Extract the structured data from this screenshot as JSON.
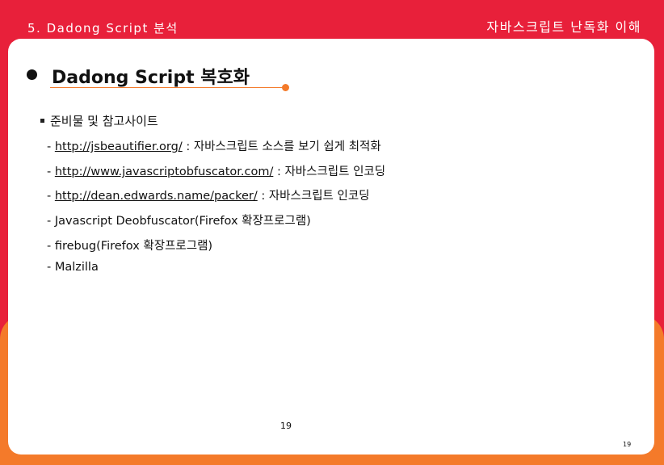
{
  "header": {
    "section": "5. Dadong Script 분석",
    "topic": "자바스크립트 난독화 이해"
  },
  "slide": {
    "title": "Dadong Script 복호화",
    "section_heading": "준비물 및 참고사이트",
    "items": [
      {
        "prefix": "- ",
        "link": "http://jsbeautifier.org/",
        "text": " : 자바스크립트 소스를 보기 쉽게 최적화"
      },
      {
        "prefix": "- ",
        "link": "http://www.javascriptobfuscator.com/",
        "text": " : 자바스크립트 인코딩"
      },
      {
        "prefix": "- ",
        "link": "http://dean.edwards.name/packer/",
        "text": " : 자바스크립트 인코딩"
      },
      {
        "prefix": "- ",
        "link": "",
        "text": "Javascript Deobfuscator(Firefox 확장프로그램)"
      },
      {
        "prefix": "- ",
        "link": "",
        "text": "firebug(Firefox 확장프로그램)"
      },
      {
        "prefix": "- ",
        "link": "",
        "text": "Malzilla"
      }
    ]
  },
  "page_number": "19",
  "page_number_corner": "19",
  "colors": {
    "frame_red": "#e8203a",
    "frame_orange": "#f47a2a",
    "text": "#111111"
  }
}
